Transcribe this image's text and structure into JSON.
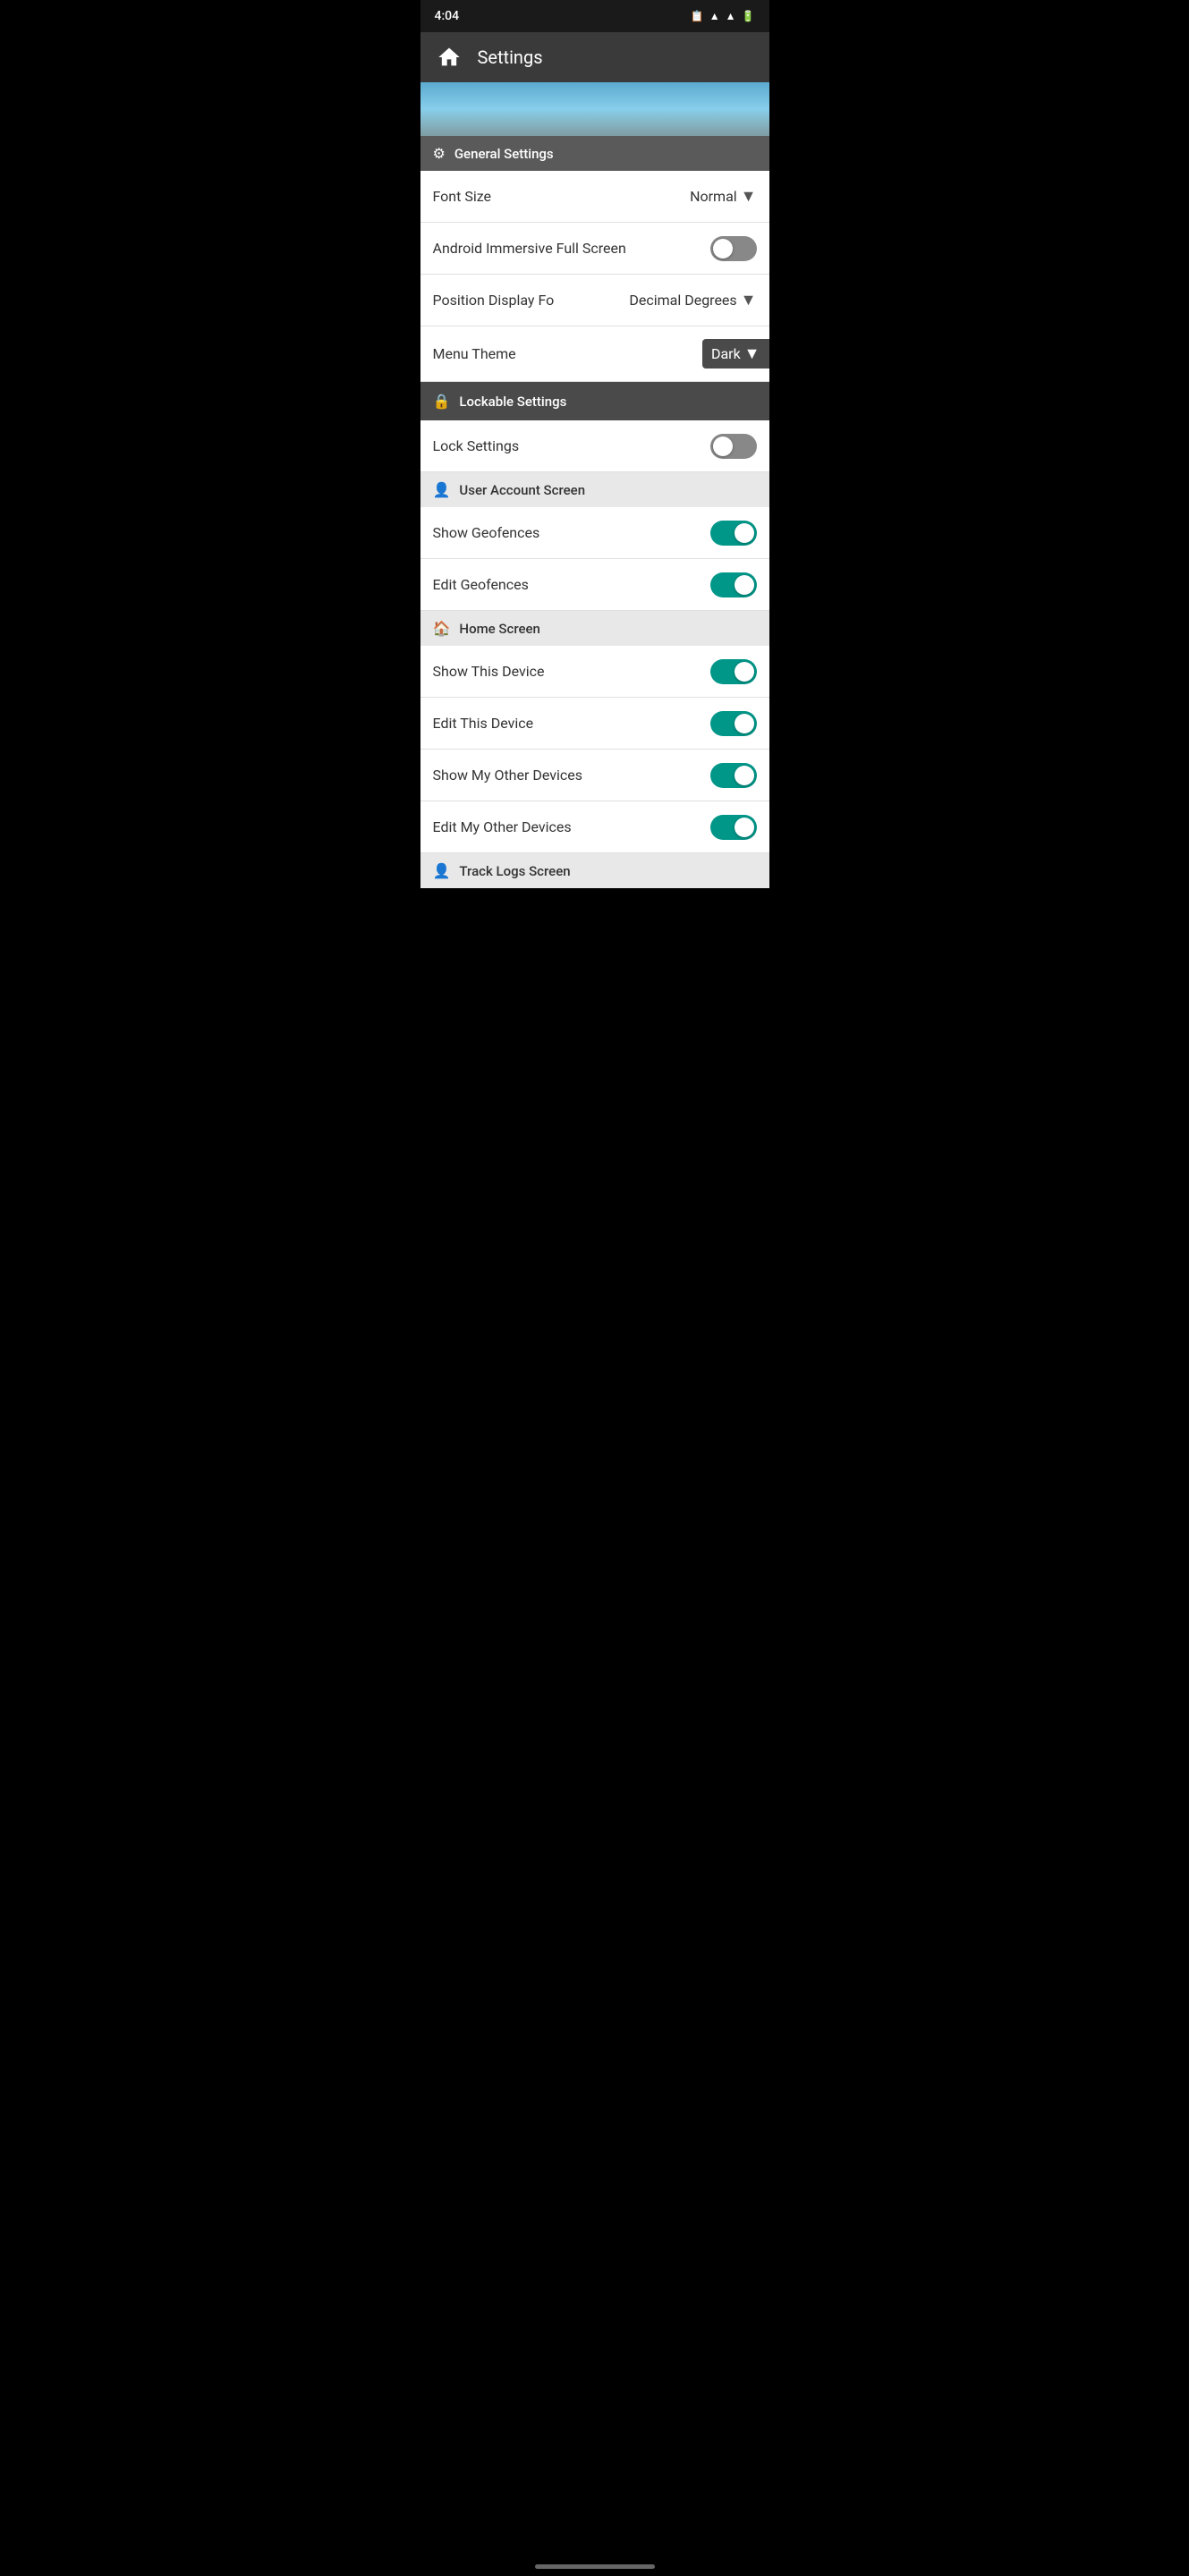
{
  "statusBar": {
    "time": "4:04",
    "batteryIcon": "🔋",
    "signalIcon": "▲",
    "wifiIcon": "▲"
  },
  "topBar": {
    "title": "Settings",
    "homeIcon": "home"
  },
  "sections": {
    "generalSettings": {
      "icon": "⚙",
      "label": "General Settings"
    },
    "lockableSettings": {
      "icon": "🔒",
      "label": "Lockable Settings"
    },
    "userAccountScreen": {
      "icon": "👤",
      "label": "User Account Screen"
    },
    "homeScreen": {
      "icon": "🏠",
      "label": "Home Screen"
    },
    "trackLogsScreen": {
      "icon": "👤",
      "label": "Track Logs Screen"
    }
  },
  "rows": {
    "fontSize": {
      "label": "Font Size",
      "value": "Normal"
    },
    "androidImmersive": {
      "label": "Android Immersive Full Screen",
      "toggleState": "off"
    },
    "positionDisplay": {
      "label": "Position Display Fo",
      "value": "Decimal Degrees"
    },
    "menuTheme": {
      "label": "Menu Theme",
      "value": "Dark"
    },
    "lockSettings": {
      "label": "Lock Settings",
      "toggleState": "off"
    },
    "showGeofences": {
      "label": "Show Geofences",
      "toggleState": "on"
    },
    "editGeofences": {
      "label": "Edit Geofences",
      "toggleState": "on"
    },
    "showThisDevice": {
      "label": "Show This Device",
      "toggleState": "on"
    },
    "editThisDevice": {
      "label": "Edit This Device",
      "toggleState": "on"
    },
    "showMyOtherDevices": {
      "label": "Show My Other Devices",
      "toggleState": "on"
    },
    "editMyOtherDevices": {
      "label": "Edit My Other Devices",
      "toggleState": "on"
    }
  },
  "colors": {
    "toggleOn": "#009688",
    "toggleOff": "#888888",
    "sectionDark": "#5a5a5a",
    "sectionLight": "#e8e8e8",
    "lockableDark": "#4a4a4a",
    "accent": "#009688"
  }
}
